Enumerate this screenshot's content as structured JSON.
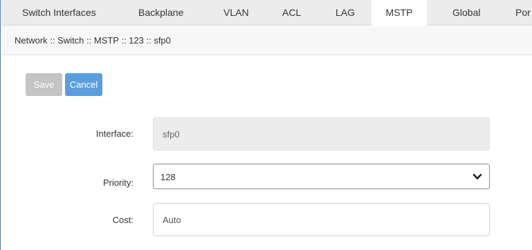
{
  "tabs": [
    {
      "label": "Switch Interfaces"
    },
    {
      "label": "Backplane"
    },
    {
      "label": "VLAN"
    },
    {
      "label": "ACL"
    },
    {
      "label": "LAG"
    },
    {
      "label": "MSTP"
    },
    {
      "label": "Global"
    },
    {
      "label": "Por"
    }
  ],
  "active_tab": "MSTP",
  "breadcrumb": "Network :: Switch :: MSTP :: 123 :: sfp0",
  "toolbar": {
    "save_label": "Save",
    "cancel_label": "Cancel"
  },
  "form": {
    "interface": {
      "label": "Interface:",
      "value": "sfp0"
    },
    "priority": {
      "label": "Priority:",
      "value": "128"
    },
    "cost": {
      "label": "Cost:",
      "placeholder": "Auto"
    }
  },
  "colors": {
    "accent": "#5b9ede",
    "disabled_button": "#c4c4c4",
    "tab_bar": "#ececec"
  },
  "icons": {
    "select_arrow": "chevron-down-icon"
  }
}
